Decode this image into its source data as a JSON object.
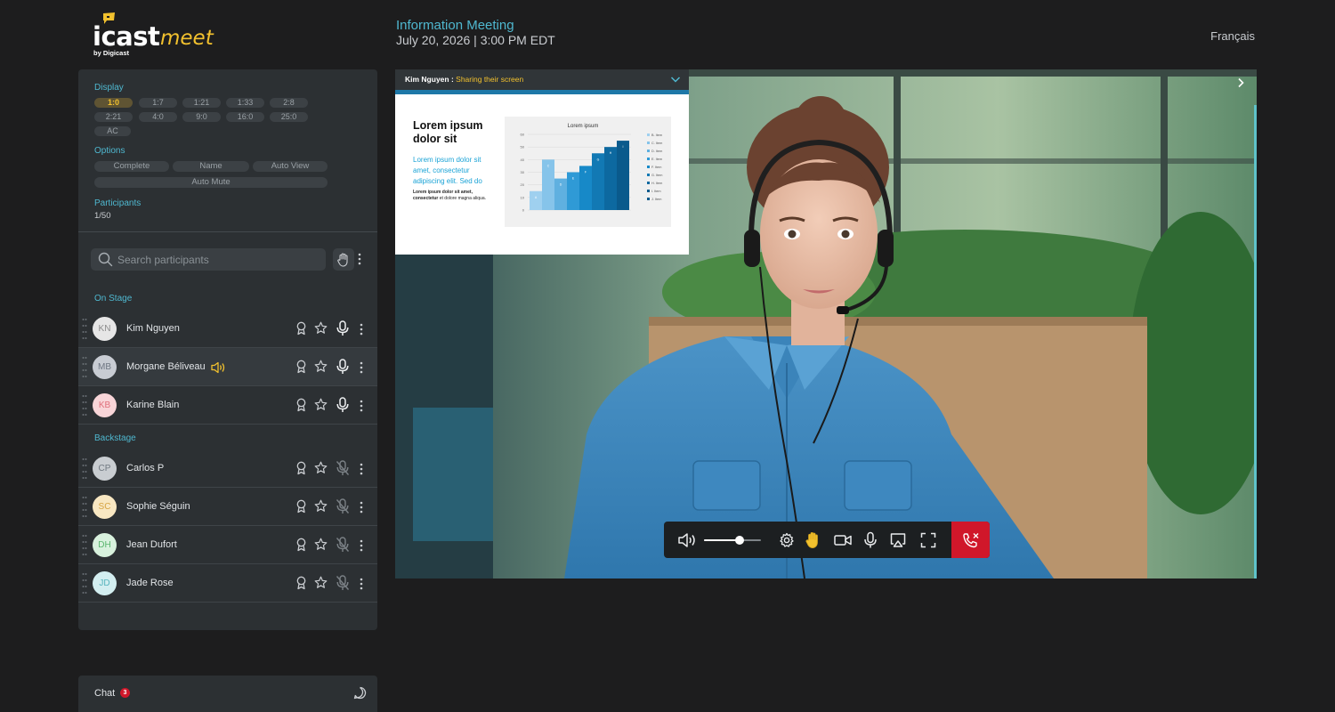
{
  "brand": {
    "name": "icast",
    "product": "meet",
    "byline": "by Digicast"
  },
  "meeting": {
    "title": "Information Meeting",
    "datetime": "July 20, 2026 | 3:00 PM EDT"
  },
  "language": "Français",
  "display": {
    "label": "Display",
    "ratios": [
      "1:0",
      "1:7",
      "1:21",
      "1:33",
      "2:8",
      "2:21",
      "4:0",
      "9:0",
      "16:0",
      "25:0",
      "AC"
    ],
    "active": "1:0"
  },
  "options": {
    "label": "Options",
    "items": [
      "Complete",
      "Name",
      "Auto View",
      "Auto Mute"
    ]
  },
  "participants_summary": {
    "label": "Participants",
    "count": "1/50"
  },
  "search": {
    "placeholder": "Search participants"
  },
  "on_stage": {
    "label": "On Stage",
    "people": [
      {
        "initials": "KN",
        "name": "Kim Nguyen",
        "avatar_bg": "#e6e6e6",
        "avatar_fg": "#8b8b8b",
        "muted": false,
        "speaking": false
      },
      {
        "initials": "MB",
        "name": "Morgane Béliveau",
        "avatar_bg": "#c8ccd3",
        "avatar_fg": "#6e7682",
        "muted": false,
        "speaking": true
      },
      {
        "initials": "KB",
        "name": "Karine Blain",
        "avatar_bg": "#f8d5d8",
        "avatar_fg": "#e0707c",
        "muted": false,
        "speaking": false
      }
    ]
  },
  "backstage": {
    "label": "Backstage",
    "people": [
      {
        "initials": "CP",
        "name": "Carlos P",
        "avatar_bg": "#c9cdd1",
        "avatar_fg": "#707880",
        "muted": true
      },
      {
        "initials": "SC",
        "name": "Sophie Séguin",
        "avatar_bg": "#f8e7c2",
        "avatar_fg": "#d6a443",
        "muted": true
      },
      {
        "initials": "DH",
        "name": "Jean Dufort",
        "avatar_bg": "#d8f1dd",
        "avatar_fg": "#5ab56d",
        "muted": true
      },
      {
        "initials": "JD",
        "name": "Jade Rose",
        "avatar_bg": "#d3eef0",
        "avatar_fg": "#55b3bd",
        "muted": true
      }
    ]
  },
  "chat": {
    "label": "Chat",
    "unread": "3"
  },
  "share": {
    "presenter": "Kim Nguyen",
    "separator": " : ",
    "status": "Sharing their screen",
    "slide_title": "Lorem ipsum dolor sit",
    "slide_subtitle": "Lorem ipsum dolor sit amet, consectetur adipiscing elit. Sed do",
    "slide_note_bold": "Lorem ipsum dolor sit amet, consectetur",
    "slide_note_rest": " et dolore magna aliqua."
  },
  "slide_chart": {
    "type": "bar",
    "title": "Lorem ipsum",
    "yticks": [
      "60",
      "50",
      "40",
      "30",
      "20",
      "10",
      "0"
    ],
    "bars": [
      {
        "label": "A",
        "value": 15,
        "color": "#9fd0ef"
      },
      {
        "label": "C",
        "value": 40,
        "color": "#86c4ea"
      },
      {
        "label": "D",
        "value": 25,
        "color": "#5fb0e0"
      },
      {
        "label": "E",
        "value": 30,
        "color": "#2f9ad6"
      },
      {
        "label": "F",
        "value": 35,
        "color": "#1789c8"
      },
      {
        "label": "G",
        "value": 45,
        "color": "#1279b4"
      },
      {
        "label": "H",
        "value": 50,
        "color": "#0d69a0"
      },
      {
        "label": "I",
        "value": 55,
        "color": "#0a5a8c"
      }
    ],
    "legend": [
      "B. Item",
      "C. Item",
      "D. Item",
      "E. Item",
      "F. Item",
      "G. Item",
      "H. Item",
      "I. Item",
      "J. Item"
    ]
  },
  "controls": {
    "volume": 0.62
  },
  "colors": {
    "accent": "#4fb8d0",
    "brand_yellow": "#f2c12e",
    "danger": "#d0172a"
  }
}
